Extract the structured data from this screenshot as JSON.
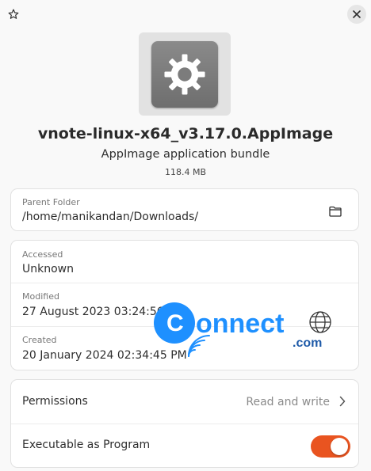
{
  "file": {
    "name": "vnote-linux-x64_v3.17.0.AppImage",
    "type": "AppImage application bundle",
    "size": "118.4 MB"
  },
  "location": {
    "label": "Parent Folder",
    "value": "/home/manikandan/Downloads/"
  },
  "dates": {
    "accessed_label": "Accessed",
    "accessed_value": "Unknown",
    "modified_label": "Modified",
    "modified_value": "27 August 2023 03:24:56 PM",
    "created_label": "Created",
    "created_value": "20 January 2024 02:34:45 PM"
  },
  "permissions": {
    "label": "Permissions",
    "value": "Read and write"
  },
  "executable": {
    "label": "Executable as Program",
    "enabled": true
  },
  "watermark": {
    "text_main": "onnect",
    "text_sub": ".com"
  },
  "colors": {
    "accent": "#e95420",
    "watermark": "#1e90ff"
  },
  "icons": {
    "star": "star-icon",
    "close": "close-icon",
    "app": "gear-icon",
    "folder": "folder-icon",
    "chevron": "chevron-right-icon"
  }
}
